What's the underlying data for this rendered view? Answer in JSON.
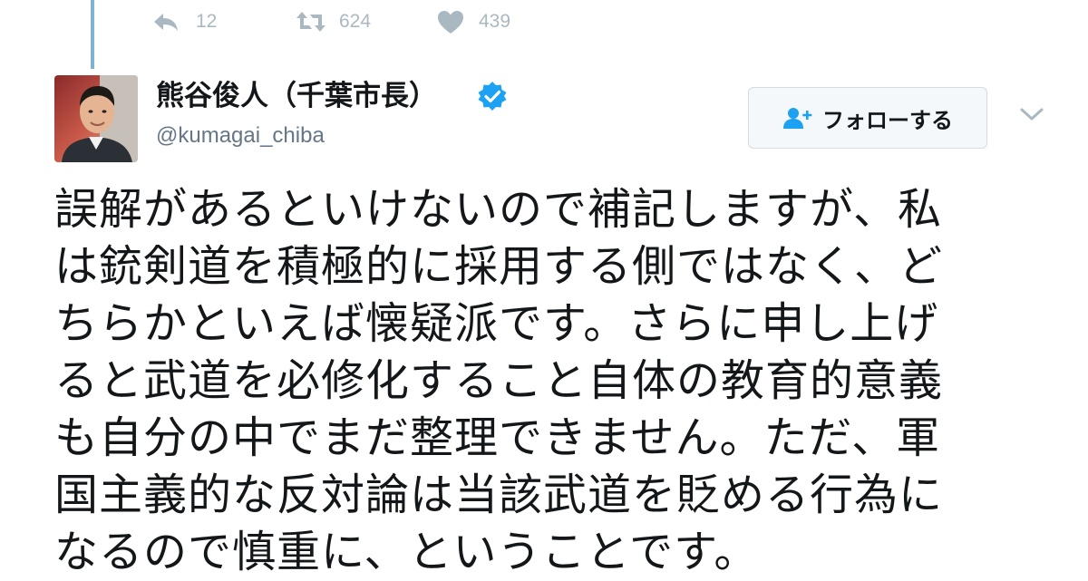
{
  "previous_tweet": {
    "actions": {
      "reply": {
        "icon": "reply-icon",
        "count": "12"
      },
      "retweet": {
        "icon": "retweet-icon",
        "count": "624"
      },
      "like": {
        "icon": "heart-icon",
        "count": "439"
      }
    }
  },
  "tweet": {
    "author": {
      "display_name": "熊谷俊人（千葉市長）",
      "verified": true,
      "handle": "@kumagai_chiba",
      "avatar_icon": "avatar"
    },
    "follow_button": {
      "label": "フォローする",
      "icon": "follow-user-icon"
    },
    "menu_icon": "chevron-down-icon",
    "text_lines": [
      "誤解があるといけないので補記しますが、私",
      "は銃剣道を積極的に採用する側ではなく、ど",
      "ちらかといえば懐疑派です。さらに申し上げ",
      "ると武道を必修化すること自体の教育的意義",
      "も自分の中でまだ整理できません。ただ、軍",
      "国主義的な反対論は当該武道を貶める行為に",
      "なるので慎重に、ということです。"
    ]
  },
  "colors": {
    "text": "#14171a",
    "secondary": "#657786",
    "action_gray": "#aab8c2",
    "verified_blue": "#1da1f2",
    "thread_line": "#7fb3cf",
    "follow_icon": "#1da1f2"
  }
}
